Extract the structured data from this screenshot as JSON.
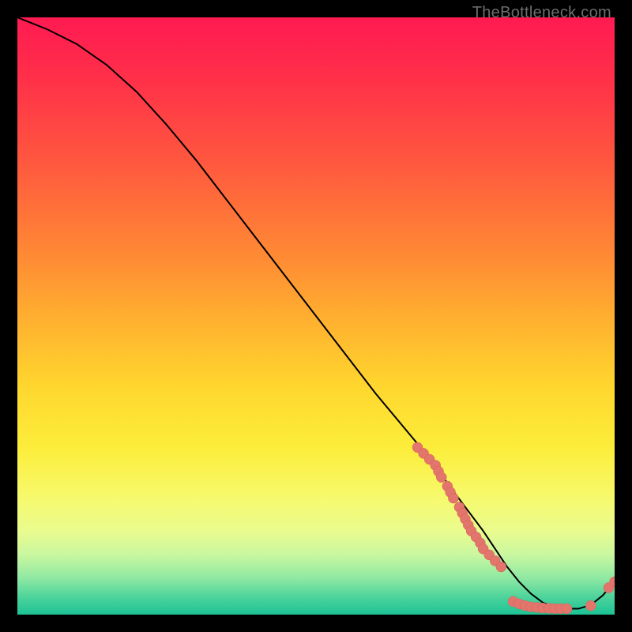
{
  "watermark": "TheBottleneck.com",
  "colors": {
    "curve_stroke": "#000000",
    "marker_fill": "#e2756c",
    "marker_stroke": "#d95f57"
  },
  "chart_data": {
    "type": "line",
    "title": "",
    "xlabel": "",
    "ylabel": "",
    "xlim": [
      0,
      100
    ],
    "ylim": [
      0,
      100
    ],
    "grid": false,
    "legend": false,
    "series": [
      {
        "name": "bottleneck-curve",
        "x": [
          0,
          5,
          10,
          15,
          20,
          25,
          30,
          35,
          40,
          45,
          50,
          55,
          60,
          65,
          70,
          72,
          75,
          78,
          80,
          82,
          84,
          86,
          88,
          90,
          92,
          94,
          96,
          98,
          100
        ],
        "y": [
          100,
          98,
          95.5,
          92,
          87.5,
          82,
          76,
          69.5,
          63,
          56.5,
          50,
          43.5,
          37,
          31,
          25,
          22,
          18,
          14,
          11,
          8,
          5.5,
          3.5,
          2,
          1.2,
          1,
          1,
          1.6,
          3.2,
          5.5
        ]
      },
      {
        "name": "markers-descent-cluster",
        "kind": "scatter",
        "x": [
          67,
          68,
          69,
          70,
          70.5,
          71,
          72,
          72.5,
          73,
          74,
          74.5,
          75,
          75.5,
          76,
          76.8,
          77.5,
          78,
          79,
          80,
          81
        ],
        "y": [
          28,
          27,
          26,
          25,
          24,
          23,
          21.5,
          20.5,
          19.5,
          18,
          17,
          16,
          15,
          14,
          13,
          12,
          11,
          10,
          9,
          8
        ]
      },
      {
        "name": "markers-bottom-cluster",
        "kind": "scatter",
        "x": [
          83,
          84,
          85,
          86,
          87,
          88,
          89,
          90,
          91,
          92,
          96
        ],
        "y": [
          2.2,
          1.8,
          1.5,
          1.3,
          1.2,
          1.1,
          1.05,
          1.0,
          1.0,
          1.0,
          1.5
        ]
      },
      {
        "name": "markers-tail-pair",
        "kind": "scatter",
        "x": [
          99,
          100
        ],
        "y": [
          4.5,
          5.5
        ]
      }
    ]
  }
}
